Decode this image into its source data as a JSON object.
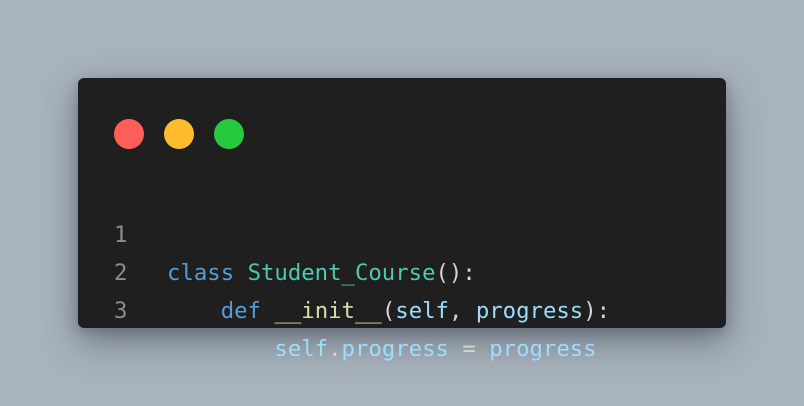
{
  "window": {
    "controls": [
      {
        "name": "close",
        "color": "#ff5f56"
      },
      {
        "name": "minimize",
        "color": "#ffbd2e"
      },
      {
        "name": "maximize",
        "color": "#27c93f"
      }
    ]
  },
  "code": {
    "language": "python",
    "lines": [
      {
        "number": "1",
        "indent": "",
        "tokens": [
          {
            "text": "class",
            "type": "keyword"
          },
          {
            "text": " ",
            "type": "space"
          },
          {
            "text": "Student_Course",
            "type": "class-name"
          },
          {
            "text": "():",
            "type": "punctuation"
          }
        ]
      },
      {
        "number": "2",
        "indent": "    ",
        "tokens": [
          {
            "text": "def",
            "type": "keyword"
          },
          {
            "text": " ",
            "type": "space"
          },
          {
            "text": "__init__",
            "type": "function"
          },
          {
            "text": "(",
            "type": "punctuation"
          },
          {
            "text": "self",
            "type": "variable"
          },
          {
            "text": ", ",
            "type": "punctuation"
          },
          {
            "text": "progress",
            "type": "variable"
          },
          {
            "text": "):",
            "type": "punctuation"
          }
        ]
      },
      {
        "number": "3",
        "indent": "        ",
        "tokens": [
          {
            "text": "self",
            "type": "variable"
          },
          {
            "text": ".",
            "type": "punctuation"
          },
          {
            "text": "progress",
            "type": "variable"
          },
          {
            "text": " = ",
            "type": "punctuation"
          },
          {
            "text": "progress",
            "type": "variable"
          }
        ]
      }
    ]
  }
}
